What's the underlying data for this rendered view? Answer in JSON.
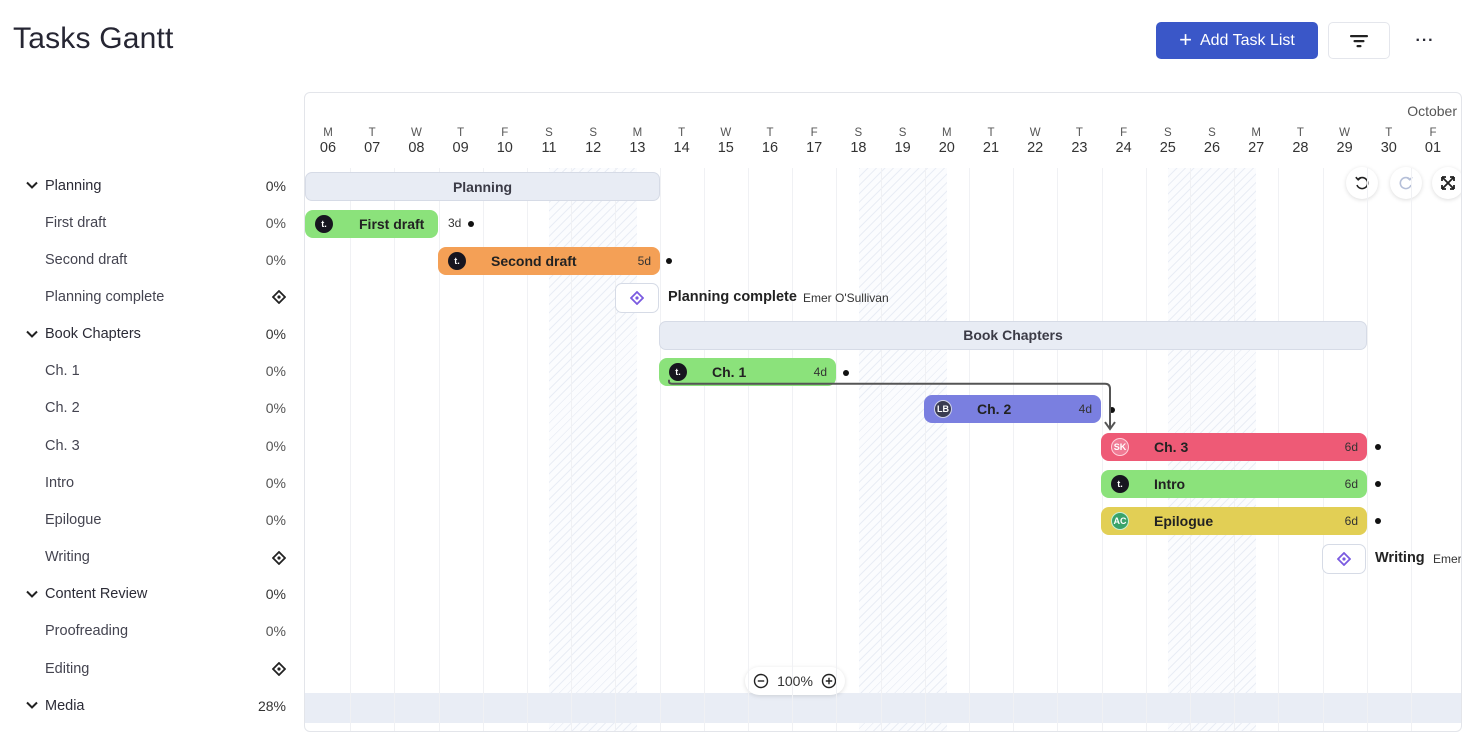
{
  "header": {
    "title": "Tasks Gantt",
    "add_label": "Add Task List"
  },
  "tree": [
    {
      "label": "Planning",
      "pct": "0%",
      "group": true
    },
    {
      "label": "First draft",
      "pct": "0%"
    },
    {
      "label": "Second draft",
      "pct": "0%"
    },
    {
      "label": "Planning complete",
      "milestone": true
    },
    {
      "label": "Book Chapters",
      "pct": "0%",
      "group": true
    },
    {
      "label": "Ch. 1",
      "pct": "0%"
    },
    {
      "label": "Ch. 2",
      "pct": "0%"
    },
    {
      "label": "Ch. 3",
      "pct": "0%"
    },
    {
      "label": "Intro",
      "pct": "0%"
    },
    {
      "label": "Epilogue",
      "pct": "0%"
    },
    {
      "label": "Writing",
      "milestone": true
    },
    {
      "label": "Content Review",
      "pct": "0%",
      "group": true
    },
    {
      "label": "Proofreading",
      "pct": "0%"
    },
    {
      "label": "Editing",
      "milestone": true
    },
    {
      "label": "Media",
      "pct": "28%",
      "group": true
    }
  ],
  "timeline": {
    "month": "October",
    "days": [
      {
        "dow": "M",
        "d": "06"
      },
      {
        "dow": "T",
        "d": "07"
      },
      {
        "dow": "W",
        "d": "08"
      },
      {
        "dow": "T",
        "d": "09"
      },
      {
        "dow": "F",
        "d": "10"
      },
      {
        "dow": "S",
        "d": "11"
      },
      {
        "dow": "S",
        "d": "12"
      },
      {
        "dow": "M",
        "d": "13"
      },
      {
        "dow": "T",
        "d": "14"
      },
      {
        "dow": "W",
        "d": "15"
      },
      {
        "dow": "T",
        "d": "16"
      },
      {
        "dow": "F",
        "d": "17"
      },
      {
        "dow": "S",
        "d": "18"
      },
      {
        "dow": "S",
        "d": "19"
      },
      {
        "dow": "M",
        "d": "20"
      },
      {
        "dow": "T",
        "d": "21"
      },
      {
        "dow": "W",
        "d": "22"
      },
      {
        "dow": "T",
        "d": "23"
      },
      {
        "dow": "F",
        "d": "24"
      },
      {
        "dow": "S",
        "d": "25"
      },
      {
        "dow": "S",
        "d": "26"
      },
      {
        "dow": "M",
        "d": "27"
      },
      {
        "dow": "T",
        "d": "28"
      },
      {
        "dow": "W",
        "d": "29"
      },
      {
        "dow": "T",
        "d": "30"
      },
      {
        "dow": "F",
        "d": "01"
      }
    ]
  },
  "bars": {
    "planning_group": "Planning",
    "chapters_group": "Book Chapters",
    "first_draft": {
      "name": "First draft",
      "dur": "3d",
      "avatar": "t."
    },
    "second_draft": {
      "name": "Second draft",
      "dur": "5d",
      "avatar": "t."
    },
    "ch1": {
      "name": "Ch. 1",
      "dur": "4d",
      "avatar": "t."
    },
    "ch2": {
      "name": "Ch. 2",
      "dur": "4d",
      "avatar": "LB"
    },
    "ch3": {
      "name": "Ch. 3",
      "dur": "6d",
      "avatar": "SK"
    },
    "intro": {
      "name": "Intro",
      "dur": "6d",
      "avatar": "t."
    },
    "epilogue": {
      "name": "Epilogue",
      "dur": "6d",
      "avatar": "AC"
    },
    "planning_complete": {
      "name": "Planning complete",
      "owner": "Emer O'Sullivan"
    },
    "writing": {
      "name": "Writing",
      "owner": "Emer"
    }
  },
  "colors": {
    "green": "#8be27b",
    "orange": "#f4a056",
    "purple": "#7a7fe0",
    "red": "#ee5a76",
    "yellow": "#e2cf55",
    "accent": "#3a57c8"
  },
  "zoom": {
    "value": "100%"
  }
}
